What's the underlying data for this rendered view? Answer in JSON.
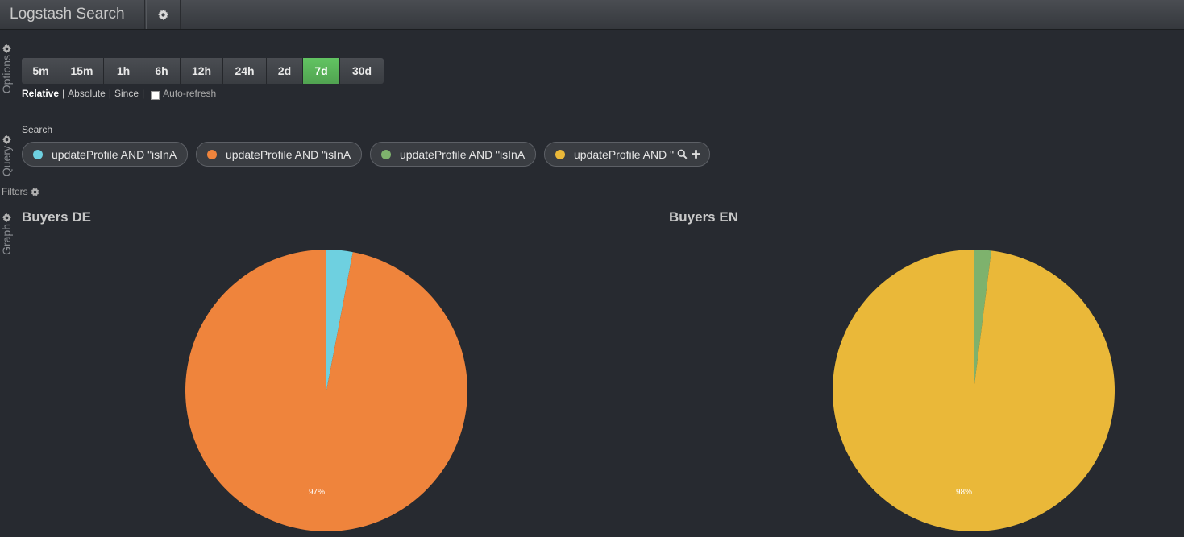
{
  "nav": {
    "title": "Logstash Search",
    "settings_icon": "gear-icon"
  },
  "rows": {
    "options": "Options",
    "query": "Query",
    "graph": "Graph"
  },
  "timepicker": {
    "buttons": [
      "5m",
      "15m",
      "1h",
      "6h",
      "12h",
      "24h",
      "2d",
      "7d",
      "30d"
    ],
    "active": "7d",
    "modes": [
      "Relative",
      "Absolute",
      "Since"
    ],
    "active_mode": "Relative",
    "auto_refresh": "Auto-refresh"
  },
  "query": {
    "label": "Search",
    "items": [
      {
        "text": "updateProfile AND \"isInA",
        "color": "#6ed0e0"
      },
      {
        "text": "updateProfile AND \"isInA",
        "color": "#ef843c"
      },
      {
        "text": "updateProfile AND \"isInA",
        "color": "#7eb26d"
      },
      {
        "text": "updateProfile AND \"",
        "color": "#eab839"
      }
    ]
  },
  "filters": {
    "label": "Filters"
  },
  "panels": [
    {
      "title": "Buyers DE",
      "chart_data": {
        "type": "pie",
        "series": [
          {
            "value": 3,
            "color": "#6ed0e0"
          },
          {
            "value": 97,
            "color": "#ef843c"
          }
        ],
        "label": "97%"
      }
    },
    {
      "title": "Buyers EN",
      "chart_data": {
        "type": "pie",
        "series": [
          {
            "value": 2,
            "color": "#7eb26d"
          },
          {
            "value": 98,
            "color": "#eab839"
          }
        ],
        "label": "98%"
      }
    }
  ]
}
